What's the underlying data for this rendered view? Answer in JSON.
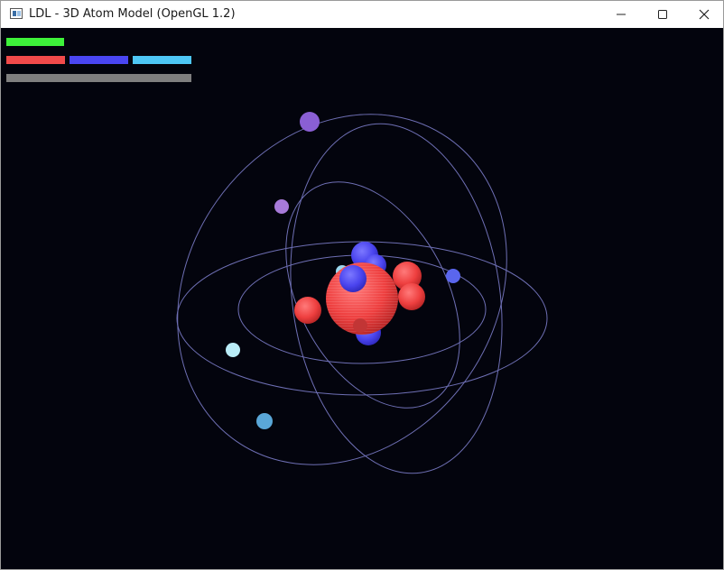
{
  "window": {
    "title": "LDL - 3D Atom Model (OpenGL 1.2)",
    "controls": {
      "minimize": "minimize",
      "maximize": "maximize",
      "close": "close"
    }
  },
  "hud": {
    "bars": [
      {
        "name": "hud-bar-green",
        "color": "#3ef23a"
      },
      {
        "name": "hud-bar-red",
        "color": "#f24a4a"
      },
      {
        "name": "hud-bar-blue",
        "color": "#4a46f2"
      },
      {
        "name": "hud-bar-cyan",
        "color": "#4ec7f5"
      },
      {
        "name": "hud-bar-gray",
        "color": "#7f7f7f"
      }
    ]
  },
  "scene": {
    "background": "#03040d",
    "orbit_color": "#6e6fb4",
    "proton_color": "#ee3f3f",
    "neutron_color": "#4a44ee",
    "electron_colors": [
      "#8a5fd4",
      "#a77ad9",
      "#5a66ee",
      "#b9ecf7",
      "#5aa7d8"
    ]
  }
}
